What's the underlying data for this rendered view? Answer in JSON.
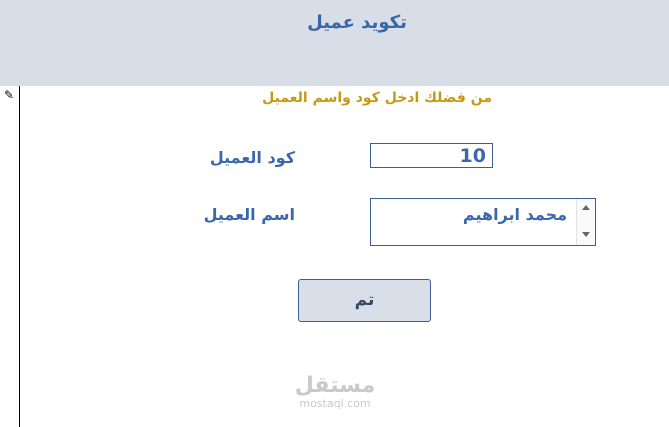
{
  "header": {
    "title": "تكويد عميل"
  },
  "form": {
    "instruction": "من فضلك ادخل كود واسم العميل",
    "code_label": "كود العميل",
    "code_value": "10",
    "name_label": "اسم العميل",
    "name_value": "محمد ابراهيم",
    "ok_label": "تم"
  },
  "watermark": {
    "arabic": "مستقل",
    "latin": "mostaql.com"
  },
  "icons": {
    "record_selector": "pencil-icon"
  }
}
